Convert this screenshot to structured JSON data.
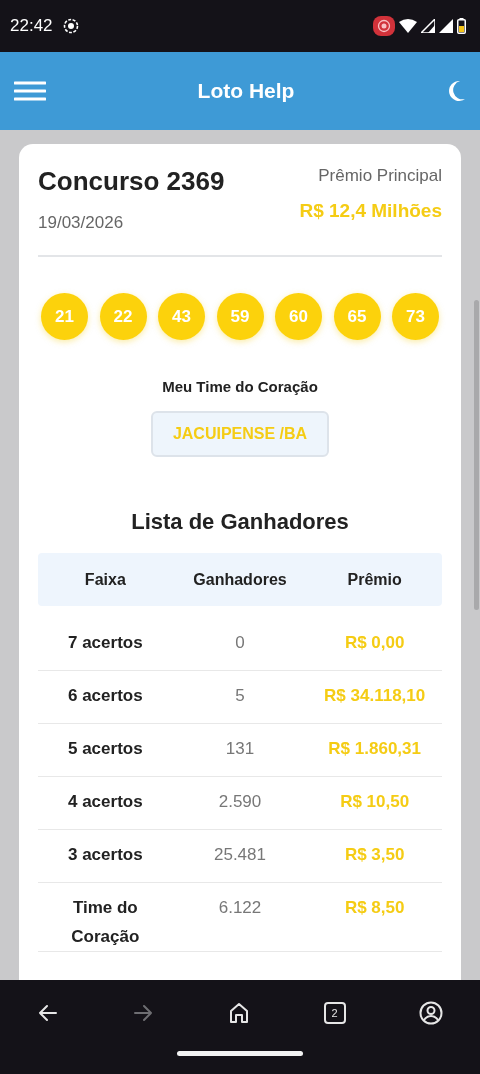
{
  "status_bar": {
    "time": "22:42"
  },
  "app_bar": {
    "title": "Loto Help"
  },
  "draw": {
    "title": "Concurso 2369",
    "date": "19/03/2026",
    "prize_label": "Prêmio Principal",
    "prize_value": "R$ 12,4 Milhões",
    "numbers": [
      "21",
      "22",
      "43",
      "59",
      "60",
      "65",
      "73"
    ],
    "team_label": "Meu Time do Coração",
    "team": "JACUIPENSE /BA"
  },
  "winners": {
    "title": "Lista de Ganhadores",
    "columns": [
      "Faixa",
      "Ganhadores",
      "Prêmio"
    ],
    "rows": [
      {
        "tier": "7 acertos",
        "winners": "0",
        "prize": "R$ 0,00"
      },
      {
        "tier": "6 acertos",
        "winners": "5",
        "prize": "R$ 34.118,10"
      },
      {
        "tier": "5 acertos",
        "winners": "131",
        "prize": "R$ 1.860,31"
      },
      {
        "tier": "4 acertos",
        "winners": "2.590",
        "prize": "R$ 10,50"
      },
      {
        "tier": "3 acertos",
        "winners": "25.481",
        "prize": "R$ 3,50"
      },
      {
        "tier": "Time do Coração",
        "winners": "6.122",
        "prize": "R$ 8,50"
      }
    ]
  },
  "browser_nav": {
    "items": [
      {
        "kind": "back",
        "disabled": false
      },
      {
        "kind": "forward",
        "disabled": true
      },
      {
        "kind": "home",
        "disabled": false
      },
      {
        "kind": "tabs",
        "label": "2",
        "disabled": false
      },
      {
        "kind": "account",
        "disabled": false
      }
    ]
  }
}
